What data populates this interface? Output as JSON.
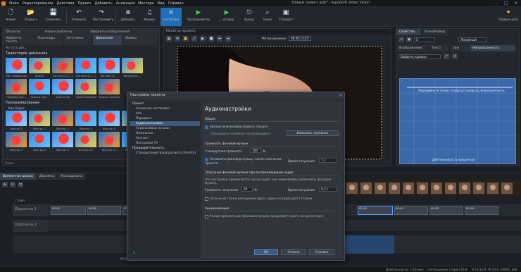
{
  "titlebar": {
    "menu": [
      "Файл",
      "Редактирование",
      "Действия",
      "Проект",
      "Добавить",
      "Анимация",
      "Мастера",
      "Вид",
      "Справка"
    ],
    "title": "Новый проект.adp* - AquaSoft Video Vision"
  },
  "ribbon": {
    "buttons": [
      {
        "label": "Новый",
        "icon": "🗋"
      },
      {
        "label": "Открыть",
        "icon": "📂"
      },
      {
        "label": "Сохранить",
        "icon": "💾"
      },
      {
        "label": "Отменить",
        "icon": "↶"
      },
      {
        "label": "Восстановить",
        "icon": "↷"
      },
      {
        "label": "Добавить",
        "icon": "⊕"
      },
      {
        "label": "Музыка",
        "icon": "♫"
      },
      {
        "label": "Настройки",
        "icon": "≡"
      },
      {
        "label": "Воспроизвести",
        "icon": "▶"
      },
      {
        "label": "... отсюда",
        "icon": "▶"
      },
      {
        "label": "Выход",
        "icon": "⎋"
      },
      {
        "label": "Поиск",
        "icon": "⌕"
      },
      {
        "label": "Стандарт",
        "icon": "▣"
      }
    ],
    "right_label": "Первые шаги"
  },
  "left_panel": {
    "tabs_row1": [
      "Объекты",
      "Новые шаблоны",
      "Эффекты изображения"
    ],
    "tabs_row2": [
      "Эффекты текста",
      "Переходы",
      "Заготовки",
      "Движение",
      "Файлы"
    ],
    "path_label": "На путь дви...",
    "section1": "Траектории движения",
    "group1": [
      {
        "cap": "360 поворотов"
      },
      {
        "cap": "Игрок"
      },
      {
        "cap": "Заглянуть (...)"
      },
      {
        "cap": "Заглянуть (...)"
      },
      {
        "cap": "Заглянуть ..."
      },
      {
        "cap": "Заглянуть ..."
      },
      {
        "cap": "Подпрыгнув..."
      },
      {
        "cap": "Тряска чер..."
      },
      {
        "cap": "Трясто 3D"
      },
      {
        "cap": "Трясостроение"
      },
      {
        "cap": "Трясостроение"
      }
    ],
    "section2": "Панорамирование",
    "subsection2": "Как Бёрнс",
    "group2": [
      {
        "cap": "Внутрь 1"
      },
      {
        "cap": "Внутрь 2"
      },
      {
        "cap": "Внутрь 3"
      },
      {
        "cap": "Внутрь 4"
      },
      {
        "cap": "Внутрь 5"
      },
      {
        "cap": "Внутрь 6"
      },
      {
        "cap": "Внутрь 7"
      },
      {
        "cap": "Внутрь 8"
      },
      {
        "cap": "Внутрь 9"
      },
      {
        "cap": "Внутрь 10"
      },
      {
        "cap": "Внутрь 11"
      },
      {
        "cap": "Внутрь 12"
      }
    ],
    "search_placeholder": "Поиск"
  },
  "preview": {
    "header": "Монитор проекта",
    "time_label": "Метка времени",
    "time_value": "00:00:14:25"
  },
  "right_panel": {
    "tabs": [
      "Свойства",
      "Ручной ввод"
    ],
    "subtabs": [
      "Изображение",
      "Текст",
      "Зум",
      "Непрозрачность"
    ],
    "selector1": "Выбрать кривую",
    "selector2": "Линейный",
    "curve_hint": "Передвиньте точки, чтобы установить непрозрачность",
    "axis_label": "Длительность в процентах"
  },
  "dialog": {
    "title": "Настройки проекта",
    "tree": [
      {
        "label": "Проект",
        "level": "h"
      },
      {
        "label": "Основные настройки",
        "level": "c"
      },
      {
        "label": "Info",
        "level": "c"
      },
      {
        "label": "Передача",
        "level": "c"
      },
      {
        "label": "Аудионастройки",
        "level": "c",
        "selected": true
      },
      {
        "label": "Скринсейвер музыки",
        "level": "c"
      },
      {
        "label": "Опознание",
        "level": "c"
      },
      {
        "label": "Экспорт",
        "level": "c"
      },
      {
        "label": "Настройки TV",
        "level": "c"
      },
      {
        "label": "Предварительность",
        "level": "h"
      },
      {
        "label": "Стандартный предпросмотр (Stretch)",
        "level": "c"
      }
    ],
    "heading": "Аудионастройки",
    "general": "Общее",
    "cb1": "Автоматически фильтровать пошаге",
    "cb1_sub": "Показывать тропиков заслоняющиеся",
    "btn_reset": "Изменить тропинок",
    "bg_music": "Громкость фоновой музыки",
    "vol_label": "Стандартная громкость",
    "vol_value": "100",
    "vol_unit": "%",
    "cb2": "Затемнить фоновую музыку после окончания проекта",
    "fade_label": "Время затухания",
    "fade_value": "7 с",
    "lower_title": "Затухание фоновой музыки при воспроизведении аудио",
    "lower_desc": "Это настройки применяются, когда аудио или видеофайлы добавлены фоновую музыку.",
    "lower_vol_label": "Громкость затухания",
    "lower_vol_value": "20",
    "lower_vol_unit": "%",
    "lower_fade_label": "Время затухания",
    "lower_fade_value": "0,2 с",
    "cb3": "Затухание также для музыки вдоль аудио из видео для 1 строки",
    "sync": "Синхронизация",
    "cb4": "Режим презентации (фоновая музыка продолжит играть во время пауз)",
    "ok": "OK",
    "cancel": "Отмена",
    "help": "Справка"
  },
  "timeline": {
    "tabs": [
      "Временная шкала",
      "Дорожка",
      "Раскадровка"
    ],
    "track1": "Дорожка 1",
    "track2": "Дорожка 2",
    "track_top": "Главн",
    "clips": [
      "00:05",
      "00:05",
      "00:05",
      "00:05",
      "00:05",
      "00:05",
      "00:05",
      "00:05",
      "00:05",
      "00:05"
    ]
  },
  "statusbar": {
    "duration": "Длительность: 1:20 мин",
    "aspect": "Соотношение сторон 16:9",
    "version": "D 14.1.07, W 10.0, 19045, x64"
  }
}
